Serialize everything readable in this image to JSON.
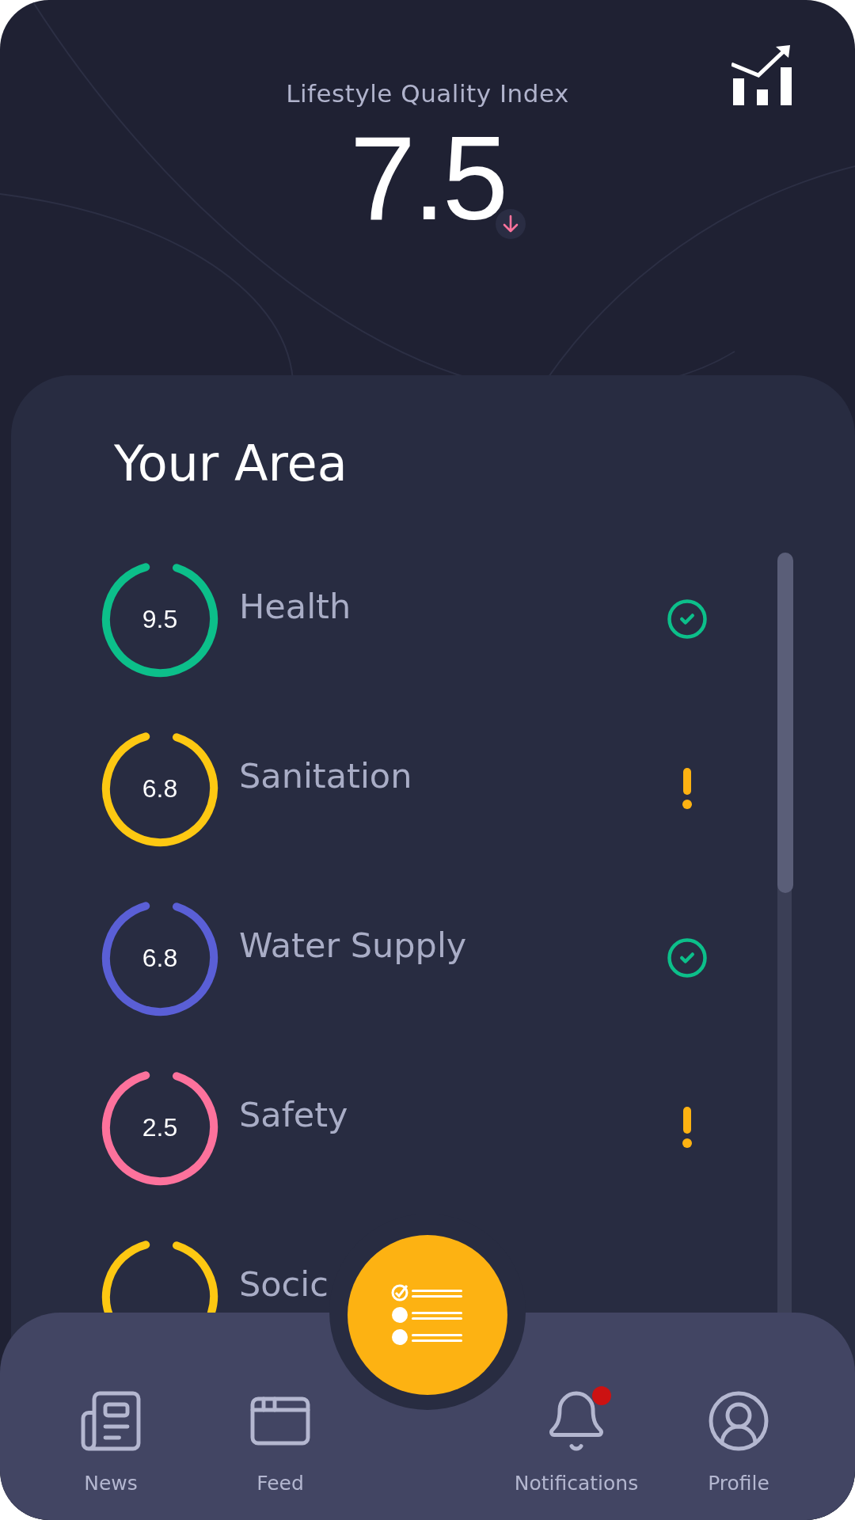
{
  "header": {
    "title": "Lifestyle Quality Index",
    "score": "7.5",
    "falling": true
  },
  "area": {
    "title": "Your Area",
    "items": [
      {
        "value": "9.5",
        "label": "Health",
        "color": "#0cbf8a",
        "warning": false
      },
      {
        "value": "6.8",
        "label": "Sanitation",
        "color": "#fdc812",
        "warning": true
      },
      {
        "value": "6.8",
        "label": "Water Supply",
        "color": "#5a5fd6",
        "warning": false
      },
      {
        "value": "2.5",
        "label": "Safety",
        "color": "#fd729c",
        "warning": true
      },
      {
        "label": "Socic",
        "color": "#fdc812"
      }
    ]
  },
  "nav": {
    "items": [
      {
        "label": "News",
        "badge": false
      },
      {
        "label": "Feed",
        "badge": false
      },
      {
        "label": "Notifications",
        "badge": true
      },
      {
        "label": "Profile",
        "badge": false
      }
    ]
  }
}
